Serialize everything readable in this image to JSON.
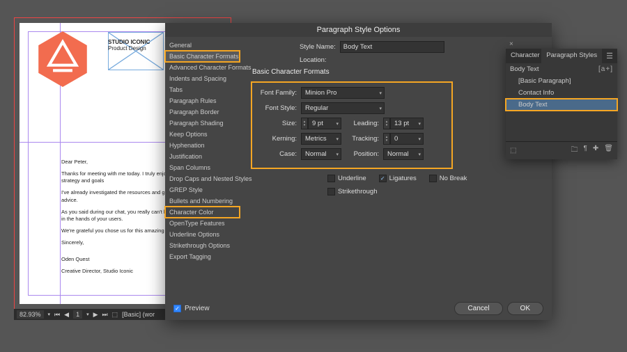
{
  "document": {
    "studio_line1": "STUDIO ICONIC",
    "studio_line2": "Product Design",
    "letter": {
      "greeting": "Dear Peter,",
      "p1": "Thanks for meeting with me today. I truly enjoyed our content strategy and goals",
      "p2": "I've already investigated the resources and guidelines y your helpful advice.",
      "p3": "As you said during our chat, you really can't learn ever fabricated and in the hands of your users.",
      "p4": "We're grateful you chose us for this amazing project, as",
      "signoff": "Sincerely,",
      "name": "Oden Quest",
      "title": "Creative Director, Studio Iconic"
    }
  },
  "zoom_bar": {
    "zoom": "82.93%",
    "page": "1",
    "status": "[Basic] (wor"
  },
  "dialog": {
    "title": "Paragraph Style Options",
    "style_name_label": "Style Name:",
    "style_name_value": "Body Text",
    "location_label": "Location:",
    "categories": [
      "General",
      "Basic Character Formats",
      "Advanced Character Formats",
      "Indents and Spacing",
      "Tabs",
      "Paragraph Rules",
      "Paragraph Border",
      "Paragraph Shading",
      "Keep Options",
      "Hyphenation",
      "Justification",
      "Span Columns",
      "Drop Caps and Nested Styles",
      "GREP Style",
      "Bullets and Numbering",
      "Character Color",
      "OpenType Features",
      "Underline Options",
      "Strikethrough Options",
      "Export Tagging"
    ],
    "section_header": "Basic Character Formats",
    "fields": {
      "font_family_label": "Font Family:",
      "font_family_value": "Minion Pro",
      "font_style_label": "Font Style:",
      "font_style_value": "Regular",
      "size_label": "Size:",
      "size_value": "9 pt",
      "leading_label": "Leading:",
      "leading_value": "13 pt",
      "kerning_label": "Kerning:",
      "kerning_value": "Metrics",
      "tracking_label": "Tracking:",
      "tracking_value": "0",
      "case_label": "Case:",
      "case_value": "Normal",
      "position_label": "Position:",
      "position_value": "Normal"
    },
    "checks": {
      "underline": "Underline",
      "ligatures": "Ligatures",
      "no_break": "No Break",
      "strike": "Strikethrough"
    },
    "preview": "Preview",
    "cancel": "Cancel",
    "ok": "OK"
  },
  "panel": {
    "tab1": "Character S",
    "tab2": "Paragraph Styles",
    "head": "Body Text",
    "new_icon": "[a+]",
    "items": [
      "[Basic Paragraph]",
      "Contact Info",
      "Body Text"
    ]
  }
}
